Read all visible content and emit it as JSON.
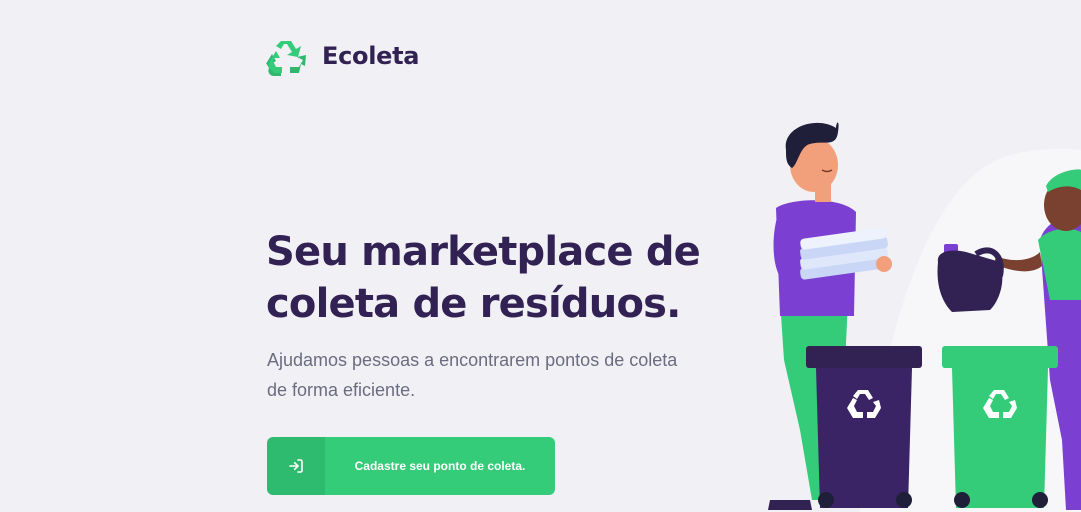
{
  "header": {
    "logo_icon": "recycle-icon",
    "brand_name": "Ecoleta"
  },
  "hero": {
    "title_line1": "Seu marketplace de",
    "title_line2": "coleta de resíduos.",
    "description_line1": "Ajudamos pessoas a encontrarem pontos de coleta",
    "description_line2": "de forma eficiente."
  },
  "cta": {
    "icon": "log-in-icon",
    "label": "Cadastre seu ponto de coleta."
  },
  "colors": {
    "background": "#f0f0f5",
    "primary": "#34cb79",
    "title": "#322153",
    "text": "#6c6c80"
  }
}
